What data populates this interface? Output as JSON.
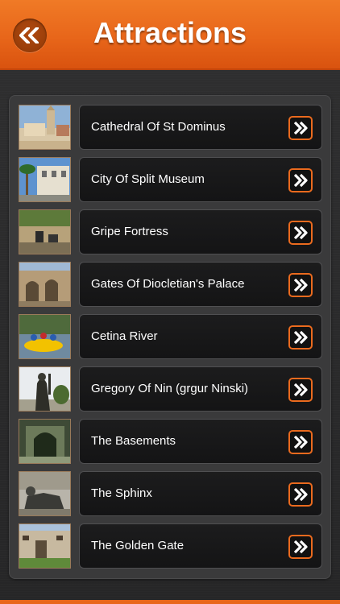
{
  "header": {
    "title": "Attractions",
    "back_icon": "double-chevron-left-icon",
    "accent": "#e8661a"
  },
  "attractions": [
    {
      "name": "Cathedral Of St Dominus",
      "thumb": "cathedral",
      "arrow_icon": "double-chevron-right-icon"
    },
    {
      "name": "City Of Split Museum",
      "thumb": "museum",
      "arrow_icon": "double-chevron-right-icon"
    },
    {
      "name": "Gripe Fortress",
      "thumb": "fortress",
      "arrow_icon": "double-chevron-right-icon"
    },
    {
      "name": "Gates Of Diocletian's Palace",
      "thumb": "gates",
      "arrow_icon": "double-chevron-right-icon"
    },
    {
      "name": "Cetina River",
      "thumb": "river",
      "arrow_icon": "double-chevron-right-icon"
    },
    {
      "name": "Gregory Of Nin (grgur Ninski)",
      "thumb": "statue",
      "arrow_icon": "double-chevron-right-icon"
    },
    {
      "name": "The Basements",
      "thumb": "basements",
      "arrow_icon": "double-chevron-right-icon"
    },
    {
      "name": "The Sphinx",
      "thumb": "sphinx",
      "arrow_icon": "double-chevron-right-icon"
    },
    {
      "name": "The Golden Gate",
      "thumb": "goldengate",
      "arrow_icon": "double-chevron-right-icon"
    }
  ]
}
